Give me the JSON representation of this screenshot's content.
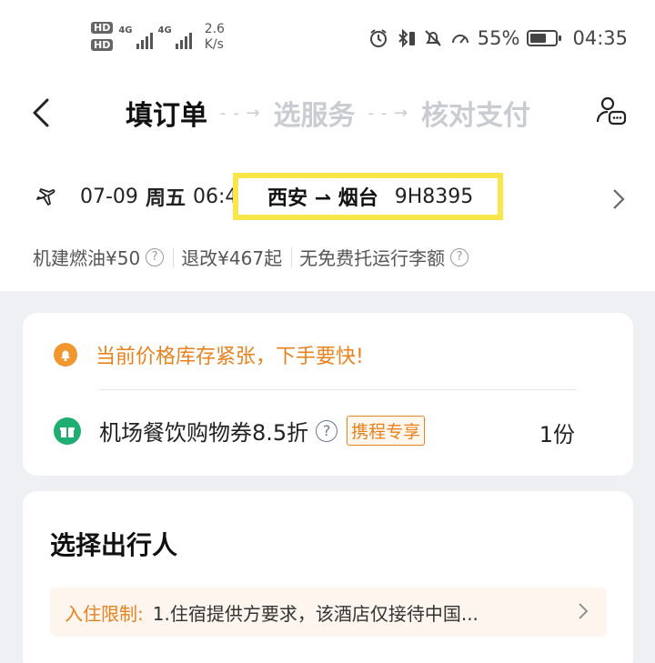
{
  "status_bar": {
    "hd1": "HD",
    "hd2": "HD",
    "sig1_label": "4G",
    "sig2_label": "4G",
    "speed_value": "2.6",
    "speed_unit": "K/s",
    "battery_percent": "55%",
    "time": "04:35"
  },
  "header": {
    "step1": "填订单",
    "step2": "选服务",
    "step3": "核对支付",
    "arrow": "- - →"
  },
  "flight": {
    "date": "07-09",
    "weekday": "周五",
    "time": "06:4",
    "route": "西安 ⇀ 烟台",
    "flight_no": "9H8395"
  },
  "fees": {
    "airport_fuel": "机建燃油¥50",
    "refund_change": "退改¥467起",
    "baggage": "无免费托运行李额"
  },
  "card1": {
    "warning": "当前价格库存紧张，下手要快!",
    "coupon_text": "机场餐饮购物券8.5折",
    "coupon_tag": "携程专享",
    "quantity": "1份"
  },
  "card2": {
    "title": "选择出行人",
    "notice_label": "入住限制:",
    "notice_text": "1.住宿提供方要求，该酒店仅接待中国..."
  },
  "colors": {
    "accent_orange": "#e8821e",
    "highlight_yellow": "#f8e64b",
    "gift_green": "#1fae72",
    "dim_step": "#c9ccd2"
  }
}
